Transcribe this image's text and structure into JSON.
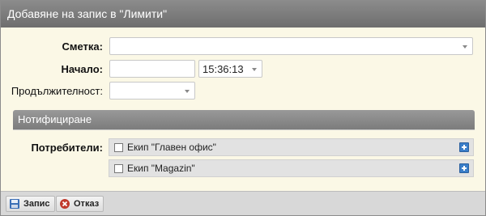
{
  "dialog": {
    "title": "Добавяне на запис в \"Лимити\""
  },
  "form": {
    "account_label": "Сметка",
    "account_value": "",
    "start_label": "Начало",
    "start_date_value": "",
    "start_time_value": "15:36:13",
    "duration_label": "Продължителност",
    "duration_value": ""
  },
  "notifications": {
    "section_title": "Нотифициране",
    "users_label": "Потребители",
    "teams": [
      {
        "label": "Екип \"Главен офис\"",
        "checked": false
      },
      {
        "label": "Екип \"Magazin\"",
        "checked": false
      }
    ]
  },
  "footer": {
    "save_label": "Запис",
    "cancel_label": "Отказ"
  },
  "colors": {
    "titlebar": "#7d7d7d",
    "form_background": "#fbf8e6",
    "plus_icon": "#3a7ec9",
    "cancel_icon": "#c0392b"
  }
}
